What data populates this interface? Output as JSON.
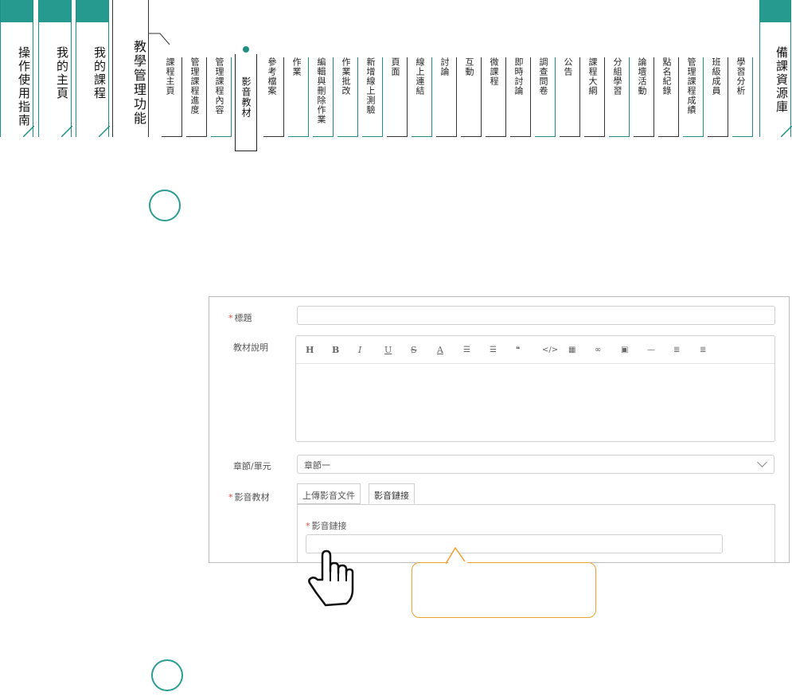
{
  "main_tabs": [
    {
      "label": "操作使用指南"
    },
    {
      "label": "我的主頁"
    },
    {
      "label": "我的課程"
    },
    {
      "label": "教學管理功能"
    }
  ],
  "right_tab": {
    "label": "備課資源庫"
  },
  "sub_tabs": [
    "課程主頁",
    "管理課程進度",
    "管理課程內容",
    "影音教材",
    "參考檔案",
    "作業",
    "編輯與刪除作業",
    "作業批改",
    "新增線上測驗",
    "頁面",
    "線上連結",
    "討論",
    "互動",
    "微課程",
    "即時討論",
    "調查問卷",
    "公告",
    "課程大綱",
    "分組學習",
    "論壇活動",
    "點名紀錄",
    "管理課程成績",
    "班級成員",
    "學習分析"
  ],
  "active_sub_tab_index": 3,
  "form": {
    "title_label": "標題",
    "title_value": "",
    "description_label": "教材說明",
    "toolbar": [
      "H",
      "B",
      "I",
      "U",
      "S",
      "A",
      "ol",
      "ul",
      "quote",
      "code",
      "table",
      "link",
      "image",
      "hr",
      "outdent",
      "indent"
    ],
    "chapter_label": "章節/單元",
    "chapter_value": "章節一",
    "media_label": "影音教材",
    "media_tabs": [
      "上傳影音文件",
      "影音鏈接"
    ],
    "active_media_tab": 1,
    "link_label": "影音鏈接",
    "link_value": ""
  },
  "colors": {
    "teal": "#279a90",
    "orange": "#f0a030",
    "required": "#e74c3c"
  },
  "icons": [
    "hand-pointer-icon",
    "chevron-down-icon"
  ]
}
